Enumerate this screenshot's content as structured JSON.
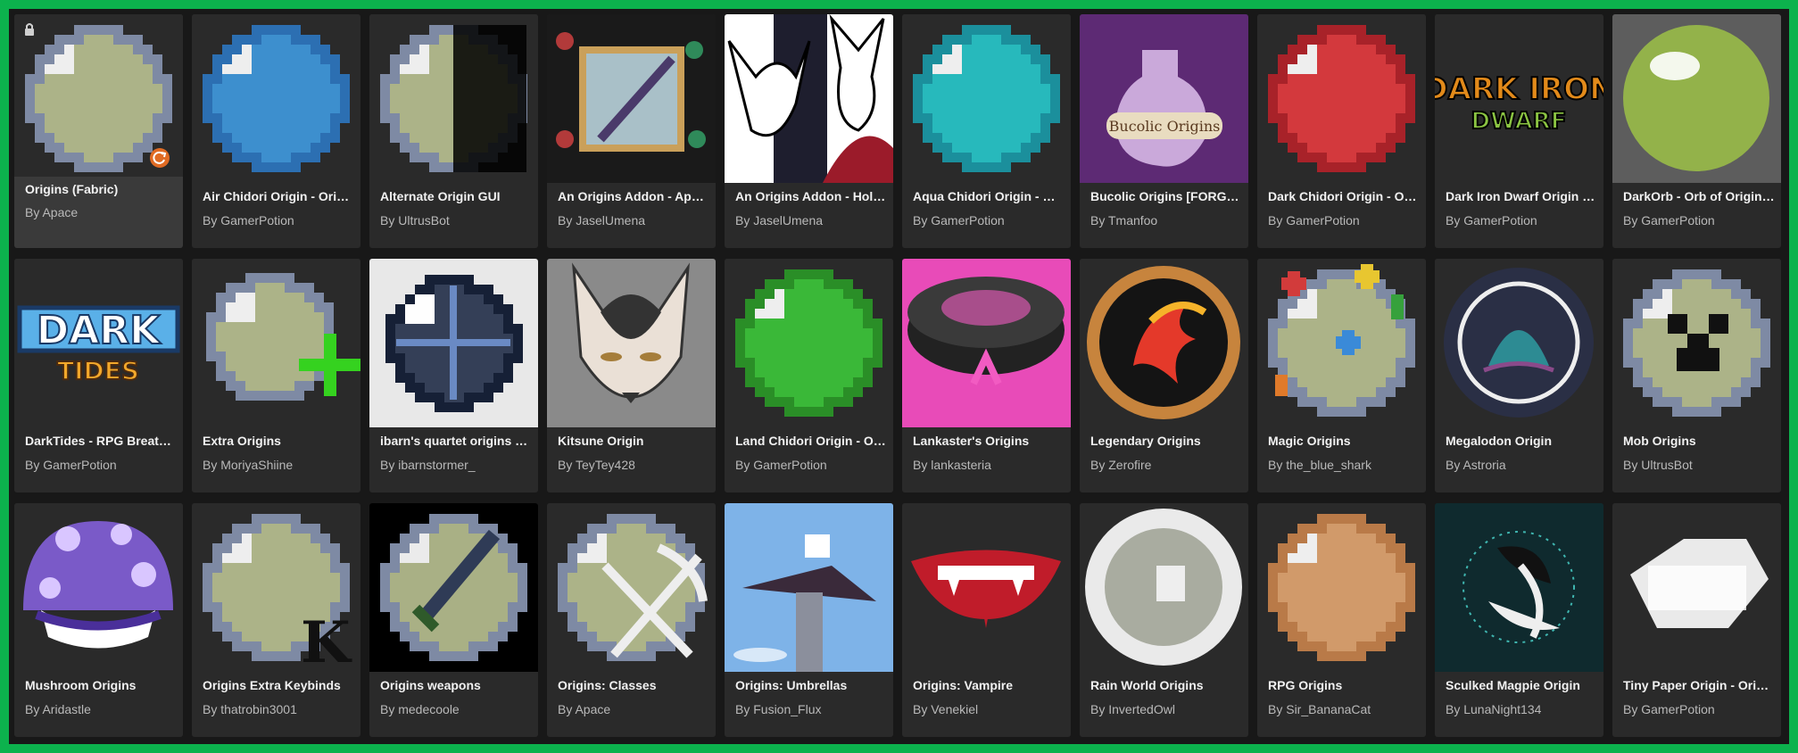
{
  "selected_index": 0,
  "icons": {
    "lock": "lock-icon",
    "update": "update-badge-icon"
  },
  "mods": [
    {
      "title": "Origins (Fabric)",
      "author": "By Apace",
      "art": "orb",
      "c1": "#b7bf90",
      "c2": "#7e8aa4"
    },
    {
      "title": "Air Chidori Origin - Origins Addon",
      "author": "By GamerPotion",
      "art": "orb",
      "c1": "#3f98dc",
      "c2": "#2c6fb2"
    },
    {
      "title": "Alternate Origin GUI",
      "author": "By UltrusBot",
      "art": "orbhalf",
      "c1": "#b7bf90",
      "c2": "#7e8aa4"
    },
    {
      "title": "An Origins Addon - Apocalypse",
      "author": "By JaselUmena",
      "art": "sword",
      "c1": "#a9c0c8",
      "c2": "#5a3b2c"
    },
    {
      "title": "An Origins Addon - Hollow Knight",
      "author": "By JaselUmena",
      "art": "knight",
      "c1": "#ffffff",
      "c2": "#1e1e2e"
    },
    {
      "title": "Aqua Chidori Origin - Origins Addon",
      "author": "By GamerPotion",
      "art": "orb",
      "c1": "#27c6c9",
      "c2": "#1b8f9c"
    },
    {
      "title": "Bucolic Origins [FORGE/FABRIC]",
      "author": "By Tmanfoo",
      "art": "potion",
      "c1": "#5d2a74",
      "c2": "#d6b7e6"
    },
    {
      "title": "Dark Chidori Origin - Origins Addon",
      "author": "By GamerPotion",
      "art": "orb",
      "c1": "#e23b3f",
      "c2": "#a82229"
    },
    {
      "title": "Dark Iron Dwarf Origin - Origins Addon",
      "author": "By GamerPotion",
      "art": "logo1",
      "c1": "#e28a1a",
      "c2": "#181818"
    },
    {
      "title": "DarkOrb - Orb of Origins Retexture",
      "author": "By GamerPotion",
      "art": "greenorb",
      "c1": "#93b24a",
      "c2": "#5d5d5d"
    },
    {
      "title": "DarkTides - RPG Breathe of Origins",
      "author": "By GamerPotion",
      "art": "logo2",
      "c1": "#5ab0e8",
      "c2": "#f3a82b"
    },
    {
      "title": "Extra Origins",
      "author": "By MoriyaShiine",
      "art": "orbplus",
      "c1": "#b7bf90",
      "c2": "#7e8aa4"
    },
    {
      "title": "ibarn's quartet origins addon",
      "author": "By ibarnstormer_",
      "art": "darkorb",
      "c1": "#24304a",
      "c2": "#e8e8e8"
    },
    {
      "title": "Kitsune Origin",
      "author": "By TeyTey428",
      "art": "fox",
      "c1": "#8a8a8a",
      "c2": "#eae0d6"
    },
    {
      "title": "Land Chidori Origin - Origins Addon",
      "author": "By GamerPotion",
      "art": "orb",
      "c1": "#3cc43a",
      "c2": "#2a8e27"
    },
    {
      "title": "Lankaster's Origins",
      "author": "By lankasteria",
      "art": "puck",
      "c1": "#e84bb8",
      "c2": "#222222"
    },
    {
      "title": "Legendary Origins",
      "author": "By Zerofire",
      "art": "coin",
      "c1": "#c7843d",
      "c2": "#141414"
    },
    {
      "title": "Magic Origins",
      "author": "By the_blue_shark",
      "art": "orbmagic",
      "c1": "#b7bf90",
      "c2": "#7e8aa4"
    },
    {
      "title": "Megalodon Origin",
      "author": "By Astroria",
      "art": "shark",
      "c1": "#2a2f45",
      "c2": "#2d8b93"
    },
    {
      "title": "Mob Origins",
      "author": "By UltrusBot",
      "art": "orbcreeper",
      "c1": "#b7bf90",
      "c2": "#7e8aa4"
    },
    {
      "title": "Mushroom Origins",
      "author": "By Aridastle",
      "art": "mushroom",
      "c1": "#7a5ac8",
      "c2": "#ffffff"
    },
    {
      "title": "Origins Extra Keybinds",
      "author": "By thatrobin3001",
      "art": "orbk",
      "c1": "#b7bf90",
      "c2": "#7e8aa4"
    },
    {
      "title": "Origins weapons",
      "author": "By medecoole",
      "art": "orbsword",
      "c1": "#b7bf90",
      "c2": "#7e8aa4"
    },
    {
      "title": "Origins: Classes",
      "author": "By Apace",
      "art": "orbtools",
      "c1": "#b7bf90",
      "c2": "#7e8aa4"
    },
    {
      "title": "Origins: Umbrellas",
      "author": "By Fusion_Flux",
      "art": "umbrella",
      "c1": "#7eb3e8",
      "c2": "#3a2a3a"
    },
    {
      "title": "Origins: Vampire",
      "author": "By Venekiel",
      "art": "lips",
      "c1": "#c01c2a",
      "c2": "#2a2a2a"
    },
    {
      "title": "Rain World Origins",
      "author": "By InvertedOwl",
      "art": "whiteorb",
      "c1": "#eaeaea",
      "c2": "#a9aca0"
    },
    {
      "title": "RPG Origins",
      "author": "By Sir_BananaCat",
      "art": "orb",
      "c1": "#e0a470",
      "c2": "#b97a48"
    },
    {
      "title": "Sculked Magpie Origin",
      "author": "By LunaNight134",
      "art": "magpie",
      "c1": "#0f2a2e",
      "c2": "#3fb6b0"
    },
    {
      "title": "Tiny Paper Origin - Origins Addon",
      "author": "By GamerPotion",
      "art": "paper",
      "c1": "#eaeaea",
      "c2": "#2a2a2a"
    }
  ]
}
